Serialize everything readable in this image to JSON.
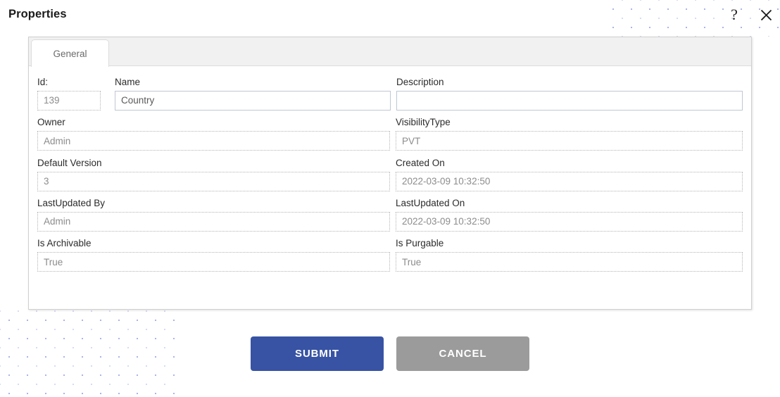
{
  "window": {
    "title": "Properties",
    "help_icon": "question-mark-icon",
    "close_icon": "close-icon",
    "help_glyph": "?",
    "close_glyph": "✕"
  },
  "tabs": [
    {
      "label": "General",
      "active": true
    }
  ],
  "form": {
    "fields": [
      {
        "key": "id",
        "label": "Id:",
        "value": "139",
        "readonly": true,
        "width": "short"
      },
      {
        "key": "name",
        "label": "Name",
        "value": "Country",
        "readonly": false,
        "width": "full"
      },
      {
        "key": "description",
        "label": "Description",
        "value": "",
        "readonly": false,
        "width": "full"
      },
      {
        "key": "owner",
        "label": "Owner",
        "value": "Admin",
        "readonly": true,
        "width": "full"
      },
      {
        "key": "visibilitytype",
        "label": "VisibilityType",
        "value": "PVT",
        "readonly": true,
        "width": "full"
      },
      {
        "key": "defaultversion",
        "label": "Default Version",
        "value": "3",
        "readonly": true,
        "width": "full"
      },
      {
        "key": "createdon",
        "label": "Created On",
        "value": "2022-03-09 10:32:50",
        "readonly": true,
        "width": "full"
      },
      {
        "key": "lastupdatedby",
        "label": "LastUpdated By",
        "value": "Admin",
        "readonly": true,
        "width": "full"
      },
      {
        "key": "lastupdatedon",
        "label": "LastUpdated On",
        "value": "2022-03-09 10:32:50",
        "readonly": true,
        "width": "full"
      },
      {
        "key": "isarchivable",
        "label": "Is Archivable",
        "value": "True",
        "readonly": true,
        "width": "full"
      },
      {
        "key": "ispurgable",
        "label": "Is Purgable",
        "value": "True",
        "readonly": true,
        "width": "full"
      }
    ]
  },
  "actions": {
    "submit_label": "SUBMIT",
    "cancel_label": "CANCEL"
  },
  "colors": {
    "submit_bg": "#3853a4",
    "cancel_bg": "#9b9b9b",
    "tabstrip_bg": "#f1f1f1",
    "dot_pattern": "#aab4e8"
  }
}
